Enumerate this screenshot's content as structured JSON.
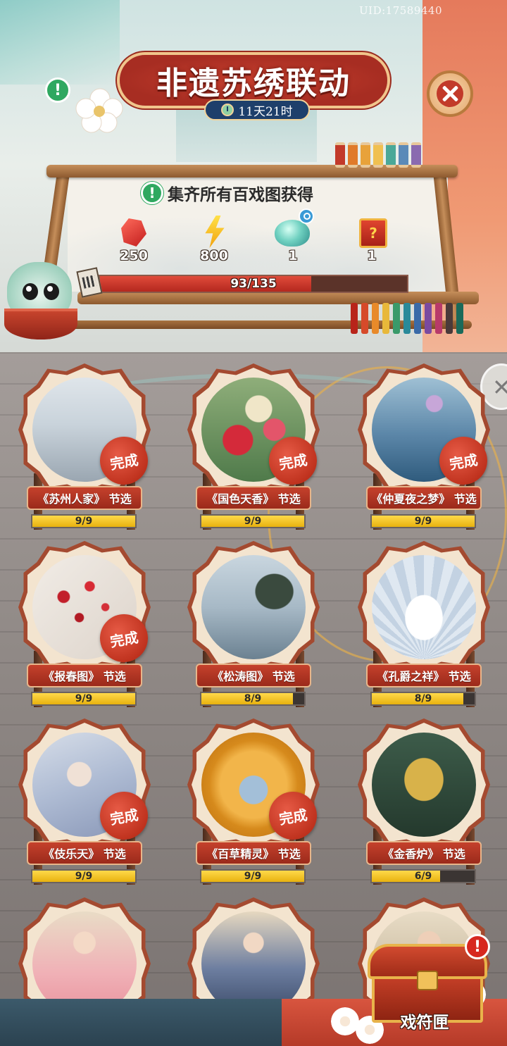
{
  "header": {
    "uid": "UID:17589440",
    "title": "非遗苏绣联动",
    "countdown": "11天21时"
  },
  "collect": {
    "label": "集齐所有百戏图获得",
    "rewards": [
      {
        "icon": "red-gem-icon",
        "count": "250"
      },
      {
        "icon": "lightning-bolt-icon",
        "count": "800"
      },
      {
        "icon": "jade-dew-icon",
        "count": "1"
      },
      {
        "icon": "mystery-chest-icon",
        "count": "1"
      }
    ],
    "progress": {
      "current": 93,
      "total": 135,
      "text": "93/135"
    }
  },
  "cards": [
    {
      "label": "《苏州人家》 节选",
      "progress_text": "9/9",
      "current": 9,
      "total": 9,
      "done": true,
      "art": "art-suzhou"
    },
    {
      "label": "《国色天香》 节选",
      "progress_text": "9/9",
      "current": 9,
      "total": 9,
      "done": true,
      "art": "art-peony"
    },
    {
      "label": "《仲夏夜之梦》 节选",
      "progress_text": "9/9",
      "current": 9,
      "total": 9,
      "done": true,
      "art": "art-lotus"
    },
    {
      "label": "《报春图》 节选",
      "progress_text": "9/9",
      "current": 9,
      "total": 9,
      "done": true,
      "art": "art-plum"
    },
    {
      "label": "《松涛图》 节选",
      "progress_text": "8/9",
      "current": 8,
      "total": 9,
      "done": false,
      "art": "art-pine"
    },
    {
      "label": "《孔爵之祥》 节选",
      "progress_text": "8/9",
      "current": 8,
      "total": 9,
      "done": false,
      "art": "art-peacock"
    },
    {
      "label": "《伎乐天》 节选",
      "progress_text": "9/9",
      "current": 9,
      "total": 9,
      "done": true,
      "art": "art-apsara"
    },
    {
      "label": "《百草精灵》 节选",
      "progress_text": "9/9",
      "current": 9,
      "total": 9,
      "done": true,
      "art": "art-monkey"
    },
    {
      "label": "《金香炉》 节选",
      "progress_text": "6/9",
      "current": 6,
      "total": 9,
      "done": false,
      "art": "art-censer"
    },
    {
      "label": "",
      "art": "art-lady",
      "partial": true
    },
    {
      "label": "",
      "art": "art-scholar",
      "partial": true
    },
    {
      "label": "",
      "art": "art-hero",
      "partial": true
    }
  ],
  "done_badge": "完成",
  "chest": {
    "label": "戏符匣",
    "alert": "!"
  },
  "alerts": {
    "top_notice": "!",
    "collect_notice": "!"
  }
}
